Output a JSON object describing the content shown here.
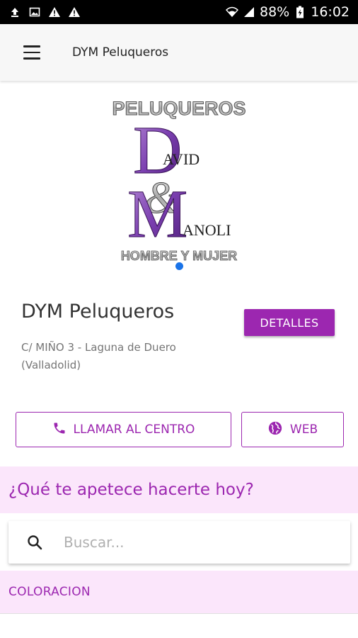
{
  "status_bar": {
    "left_icons": [
      "upload-icon",
      "image-icon",
      "warning-icon",
      "warning-icon"
    ],
    "battery": "88%",
    "time": "16:02"
  },
  "app_bar": {
    "title": "DYM Peluqueros"
  },
  "logo": {
    "top_text": "PELUQUEROS",
    "line1": "AVID",
    "line2": "ANOLI",
    "bottom_text": "HOMBRE Y MUJER"
  },
  "salon": {
    "name": "DYM Peluqueros",
    "details_label": "DETALLES",
    "address": "C/ MIÑO 3 - Laguna de Duero (Valladolid)"
  },
  "actions": {
    "call_label": "LLAMAR AL CENTRO",
    "web_label": "WEB"
  },
  "question": "¿Qué te apetece hacerte hoy?",
  "search": {
    "placeholder": "Buscar..."
  },
  "category": {
    "label": "COLORACION"
  },
  "colors": {
    "accent": "#9c27b0",
    "band_background": "#fbe6fb",
    "dot": "#1a73e8"
  }
}
